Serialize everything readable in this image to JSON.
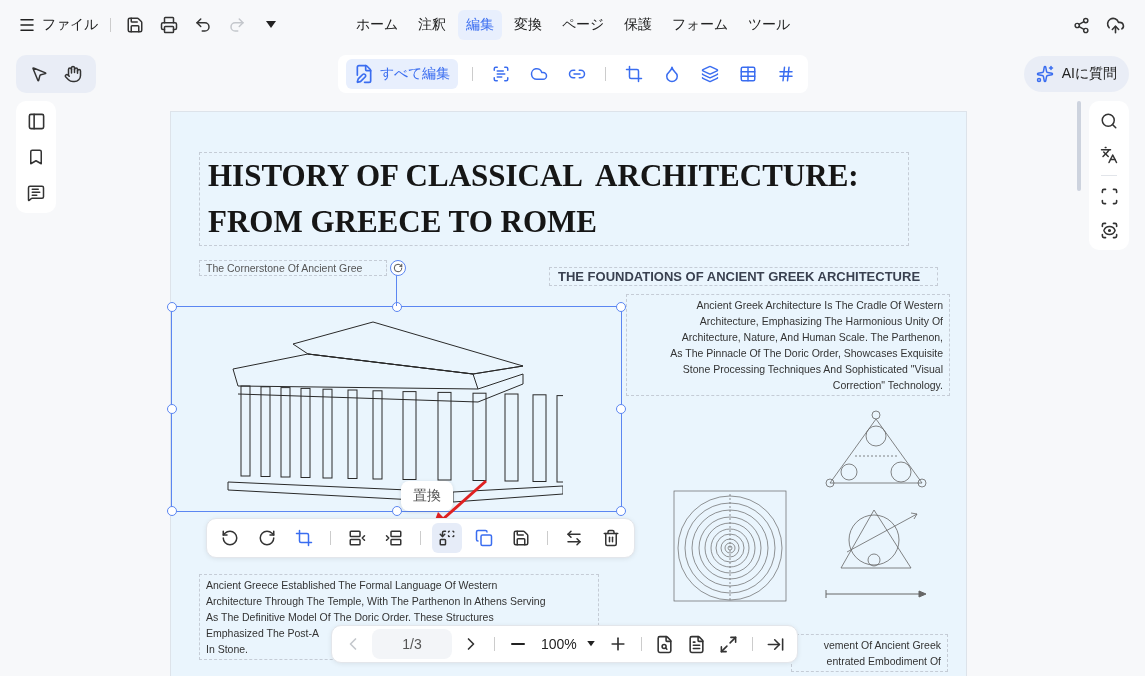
{
  "menu": {
    "label": "ファイル"
  },
  "quick_actions": [
    {
      "kind": "save",
      "disabled": false
    },
    {
      "kind": "print",
      "disabled": false
    },
    {
      "kind": "undo",
      "disabled": false
    },
    {
      "kind": "redo",
      "disabled": true
    }
  ],
  "tabs": [
    {
      "label": "ホーム",
      "selected": false
    },
    {
      "label": "注釈",
      "selected": false
    },
    {
      "label": "編集",
      "selected": true
    },
    {
      "label": "変換",
      "selected": false
    },
    {
      "label": "ページ",
      "selected": false
    },
    {
      "label": "保護",
      "selected": false
    },
    {
      "label": "フォーム",
      "selected": false
    },
    {
      "label": "ツール",
      "selected": false
    }
  ],
  "edit_toolbar": {
    "primary": {
      "label": "すべて編集",
      "selected": true
    }
  },
  "ai_button": {
    "label": "AIに質問"
  },
  "document": {
    "title_lines": [
      "HISTORY OF CLASSICAL  ARCHITECTURE:",
      "FROM GREECE TO ROME"
    ],
    "subtitle": "The Cornerstone Of Ancient Gree",
    "section_heading": "THE FOUNDATIONS OF ANCIENT GREEK ARCHITECTURE",
    "section_text": [
      "Ancient Greek Architecture Is The Cradle Of Western",
      "Architecture, Emphasizing The Harmonious Unity Of",
      "Architecture, Nature, And Human Scale. The Parthenon,",
      "As The Pinnacle Of The Doric Order, Showcases Exquisite",
      "Stone Processing Techniques And Sophisticated \"Visual",
      "Correction\" Technology."
    ],
    "lower_text": [
      "Ancient Greece Established The Formal Language Of Western",
      "Architecture Through The Temple, With The Parthenon In Athens Serving",
      "As The Definitive Model Of The Doric Order. These Structures",
      "Emphasized The Post-A",
      "In Stone."
    ],
    "lower_right_text": [
      "vement Of Ancient Greek",
      "entrated Embodiment Of"
    ]
  },
  "tooltip": "置換",
  "image_toolbar": [
    {
      "kind": "rotate-left",
      "selected": false
    },
    {
      "kind": "rotate-right",
      "selected": false
    },
    {
      "kind": "crop",
      "selected": false
    },
    {
      "kind": "send-back",
      "selected": false
    },
    {
      "kind": "bring-front",
      "selected": false
    },
    {
      "kind": "replace",
      "selected": true
    },
    {
      "kind": "copy",
      "selected": false
    },
    {
      "kind": "save",
      "selected": false
    },
    {
      "kind": "swap",
      "selected": false
    },
    {
      "kind": "delete",
      "selected": false
    }
  ],
  "pager": {
    "page": "1/3",
    "zoom": "100%"
  }
}
